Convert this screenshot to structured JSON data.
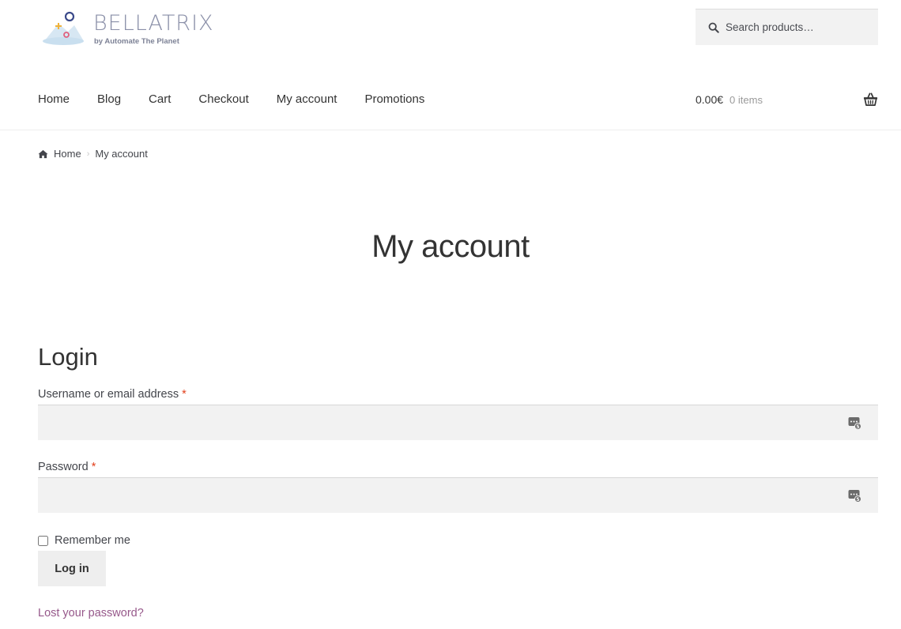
{
  "brand": {
    "name": "BELLATRIX",
    "tagline": "by Automate The Planet"
  },
  "search": {
    "placeholder": "Search products…",
    "value": ""
  },
  "nav": {
    "items": [
      {
        "label": "Home"
      },
      {
        "label": "Blog"
      },
      {
        "label": "Cart"
      },
      {
        "label": "Checkout"
      },
      {
        "label": "My account"
      },
      {
        "label": "Promotions"
      }
    ]
  },
  "cart": {
    "amount": "0.00€",
    "count": "0 items"
  },
  "breadcrumb": {
    "home": "Home",
    "current": "My account"
  },
  "page": {
    "title": "My account"
  },
  "login": {
    "title": "Login",
    "username_label": "Username or email address",
    "username_value": "",
    "password_label": "Password",
    "password_value": "",
    "required_mark": "*",
    "remember_label": "Remember me",
    "remember_checked": false,
    "submit_label": "Log in",
    "lost_password_label": "Lost your password?"
  },
  "colors": {
    "accent_link": "#96588a",
    "required": "#e2401c",
    "field_bg": "#f2f2f2",
    "button_bg": "#eeeeee"
  }
}
